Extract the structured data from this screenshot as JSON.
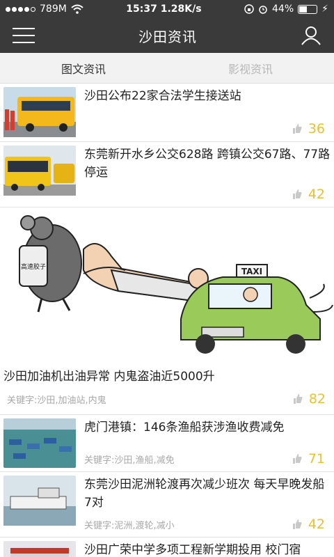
{
  "status": {
    "carrier": "789M",
    "time": "15:37",
    "speed": "1.28K/s",
    "battery": "44%",
    "battery_level": 0.44
  },
  "header": {
    "title": "沙田资讯"
  },
  "tabs": [
    {
      "label": "图文资讯",
      "active": true
    },
    {
      "label": "影视资讯",
      "active": false
    }
  ],
  "articles": [
    {
      "title": "沙田公布22家合法学生接送站",
      "keywords": "",
      "count": "36"
    },
    {
      "title": "东莞新开水乡公交628路 跨镇公交67路、77路停运",
      "keywords": "",
      "count": "42"
    },
    {
      "title": "沙田加油机出油异常 内鬼盗油近5000升",
      "keywords": "关键字:沙田,加油站,内鬼",
      "count": "82"
    },
    {
      "title": "虎门港镇：146条渔船获涉渔收费减免",
      "keywords": "关键字:沙田,渔船,减免",
      "count": "71"
    },
    {
      "title": "东莞沙田泥洲轮渡再次减少班次 每天早晚发船7对",
      "keywords": "关键字:泥洲,渡轮,减小",
      "count": "42"
    },
    {
      "title": "沙田广荣中学多项工程新学期投用 校门宿",
      "keywords": "",
      "count": ""
    }
  ],
  "illustration_text": {
    "cup": "高速胶子",
    "taxi": "TAXI"
  },
  "colors": {
    "bar": "#3a3a3a",
    "count": "#e8c033"
  }
}
